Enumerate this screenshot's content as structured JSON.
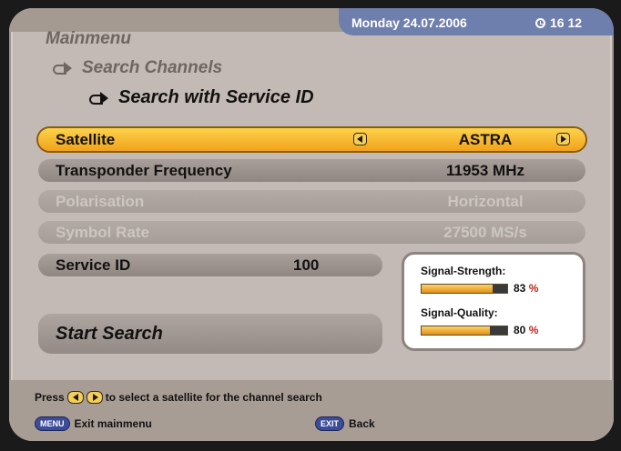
{
  "header": {
    "date": "Monday 24.07.2006",
    "time": "16 12"
  },
  "breadcrumb": {
    "level1": "Mainmenu",
    "level2": "Search Channels",
    "level3": "Search with Service ID"
  },
  "rows": {
    "satellite": {
      "label": "Satellite",
      "value": "ASTRA"
    },
    "transponder": {
      "label": "Transponder Frequency",
      "value": "11953 MHz"
    },
    "polarisation": {
      "label": "Polarisation",
      "value": "Horizontal"
    },
    "symbol_rate": {
      "label": "Symbol Rate",
      "value": "27500 MS/s"
    },
    "service_id": {
      "label": "Service ID",
      "value": "100"
    }
  },
  "start_search": "Start Search",
  "signal": {
    "strength_label": "Signal-Strength:",
    "strength_value": "83",
    "strength_unit": "%",
    "quality_label": "Signal-Quality:",
    "quality_value": "80",
    "quality_unit": "%"
  },
  "hint": {
    "press": "Press",
    "rest": "to select a satellite for the channel search"
  },
  "footer": {
    "menu_key": "MENU",
    "menu_label": "Exit mainmenu",
    "exit_key": "EXIT",
    "exit_label": "Back"
  },
  "icons": {
    "clock": "clock-icon",
    "arrow": "arrow-right-icon",
    "nav_left": "arrow-left-button-icon",
    "nav_right": "arrow-right-button-icon"
  },
  "colors": {
    "highlight": "#f2a21b",
    "panel": "#c3bab5",
    "date_bar": "#6f7fad",
    "button_blue": "#3d4c98"
  }
}
